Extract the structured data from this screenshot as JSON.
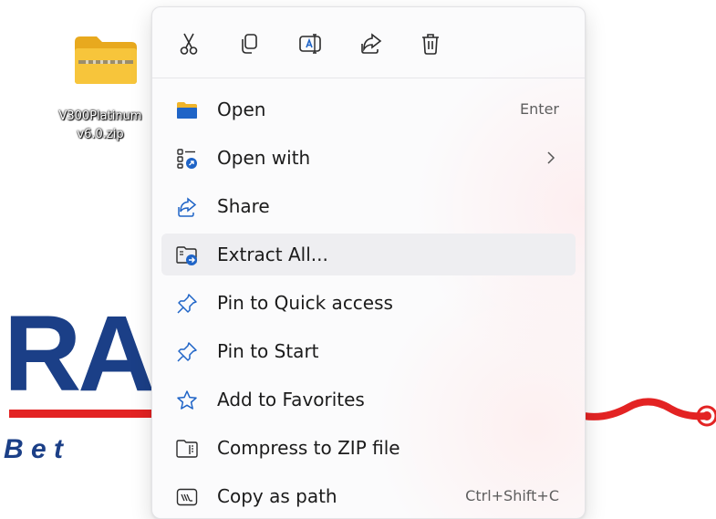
{
  "desktop": {
    "file_name_line1": "V300Platinum",
    "file_name_line2": "v6.0.zip",
    "logo_text": "RA",
    "tagline_text": "B e t"
  },
  "toolbar": {
    "buttons": [
      {
        "name": "cut",
        "icon": "scissors-icon"
      },
      {
        "name": "copy",
        "icon": "copy-icon"
      },
      {
        "name": "rename",
        "icon": "rename-icon"
      },
      {
        "name": "share",
        "icon": "share-icon"
      },
      {
        "name": "delete",
        "icon": "trash-icon"
      }
    ]
  },
  "menu": {
    "items": [
      {
        "label": "Open",
        "shortcut": "Enter",
        "icon": "folder-icon"
      },
      {
        "label": "Open with",
        "shortcut": "",
        "icon": "open-with-icon",
        "submenu": true
      },
      {
        "label": "Share",
        "shortcut": "",
        "icon": "share-icon"
      },
      {
        "label": "Extract All...",
        "shortcut": "",
        "icon": "extract-icon",
        "highlighted": true
      },
      {
        "label": "Pin to Quick access",
        "shortcut": "",
        "icon": "pin-icon"
      },
      {
        "label": "Pin to Start",
        "shortcut": "",
        "icon": "pin-icon"
      },
      {
        "label": "Add to Favorites",
        "shortcut": "",
        "icon": "star-icon"
      },
      {
        "label": "Compress to ZIP file",
        "shortcut": "",
        "icon": "zip-folder-icon"
      },
      {
        "label": "Copy as path",
        "shortcut": "Ctrl+Shift+C",
        "icon": "copy-path-icon"
      }
    ]
  },
  "colors": {
    "accent_blue": "#1f64c7",
    "folder_yellow": "#f7c53b",
    "logo_navy": "#1b3f87",
    "wallpaper_red": "#e32323",
    "hover_bg": "#eeeef1"
  }
}
